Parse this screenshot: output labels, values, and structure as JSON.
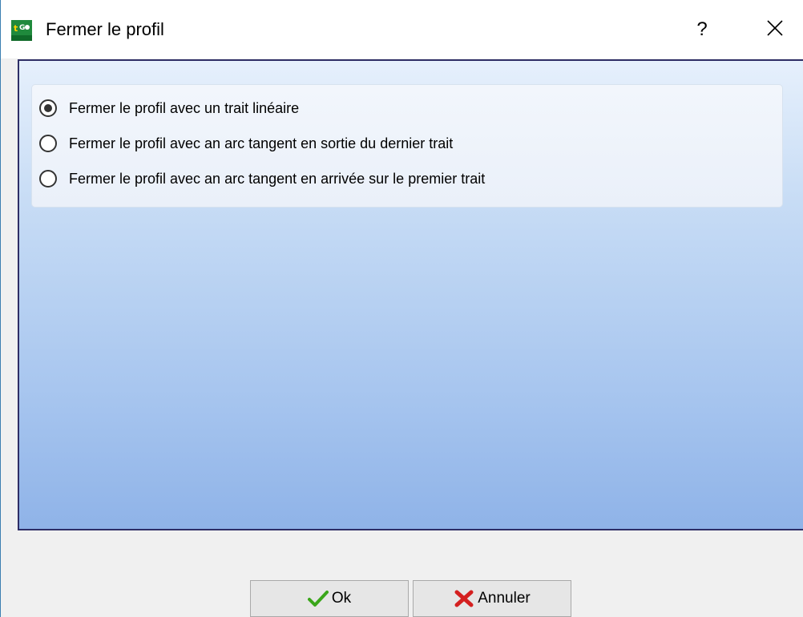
{
  "window": {
    "title": "Fermer le profil",
    "help_label": "?",
    "app_icon": "app-logo-icon",
    "close_icon": "close-icon"
  },
  "options": {
    "items": [
      {
        "label": "Fermer le profil avec un trait linéaire",
        "selected": true
      },
      {
        "label": "Fermer le profil avec an arc tangent en sortie du dernier trait",
        "selected": false
      },
      {
        "label": "Fermer le profil avec an arc tangent en arrivée sur le premier trait",
        "selected": false
      }
    ]
  },
  "footer": {
    "ok_label": "Ok",
    "ok_icon": "check-icon",
    "cancel_label": "Annuler",
    "cancel_icon": "cross-icon"
  },
  "colors": {
    "accent": "#3c7fb1",
    "panel_border": "#2e2e66",
    "ok_green": "#3aa61a",
    "cancel_red": "#d42020"
  }
}
